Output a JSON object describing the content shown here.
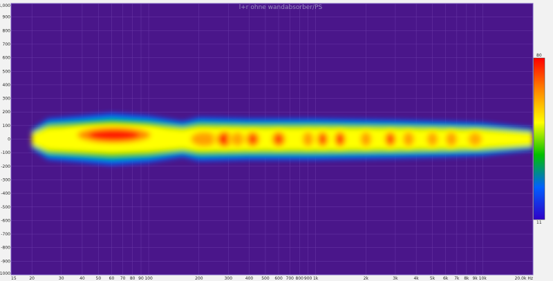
{
  "chart_data": {
    "type": "heatmap",
    "title": "l+r ohne wandabsorber/PS",
    "x_scale": "log",
    "xlim": [
      15,
      20000
    ],
    "ylim": [
      -1000,
      1000
    ],
    "x_tick_labels": [
      {
        "value": 15,
        "label": "15"
      },
      {
        "value": 20,
        "label": "20"
      },
      {
        "value": 30,
        "label": "30"
      },
      {
        "value": 40,
        "label": "40"
      },
      {
        "value": 50,
        "label": "50"
      },
      {
        "value": 60,
        "label": "60"
      },
      {
        "value": 70,
        "label": "70"
      },
      {
        "value": 80,
        "label": "80"
      },
      {
        "value": 90,
        "label": "90"
      },
      {
        "value": 100,
        "label": "100"
      },
      {
        "value": 200,
        "label": "200"
      },
      {
        "value": 300,
        "label": "300"
      },
      {
        "value": 400,
        "label": "400"
      },
      {
        "value": 500,
        "label": "500"
      },
      {
        "value": 600,
        "label": "600"
      },
      {
        "value": 700,
        "label": "700"
      },
      {
        "value": 800,
        "label": "800"
      },
      {
        "value": 900,
        "label": "900"
      },
      {
        "value": 1000,
        "label": "1k"
      },
      {
        "value": 2000,
        "label": "2k"
      },
      {
        "value": 3000,
        "label": "3k"
      },
      {
        "value": 4000,
        "label": "4k"
      },
      {
        "value": 5000,
        "label": "5k"
      },
      {
        "value": 6000,
        "label": "6k"
      },
      {
        "value": 7000,
        "label": "7k"
      },
      {
        "value": 8000,
        "label": "8k"
      },
      {
        "value": 9000,
        "label": "9k"
      },
      {
        "value": 10000,
        "label": "10k"
      },
      {
        "value": 20000,
        "label": "20.0k Hz"
      }
    ],
    "y_tick_labels": [
      {
        "value": 1000,
        "label": "1,000"
      },
      {
        "value": 900,
        "label": "900"
      },
      {
        "value": 800,
        "label": "800"
      },
      {
        "value": 700,
        "label": "700"
      },
      {
        "value": 600,
        "label": "600"
      },
      {
        "value": 500,
        "label": "500"
      },
      {
        "value": 400,
        "label": "400"
      },
      {
        "value": 300,
        "label": "300"
      },
      {
        "value": 200,
        "label": "200"
      },
      {
        "value": 100,
        "label": "100"
      },
      {
        "value": 0,
        "label": "0"
      },
      {
        "value": -100,
        "label": "-100"
      },
      {
        "value": -200,
        "label": "-200"
      },
      {
        "value": -300,
        "label": "-300"
      },
      {
        "value": -400,
        "label": "-400"
      },
      {
        "value": -500,
        "label": "-500"
      },
      {
        "value": -600,
        "label": "-600"
      },
      {
        "value": -700,
        "label": "-700"
      },
      {
        "value": -800,
        "label": "-800"
      },
      {
        "value": -900,
        "label": "-900"
      },
      {
        "value": -1000,
        "label": "-1000"
      }
    ],
    "colorbar": {
      "max_label": "80",
      "min_label": "11",
      "colors": [
        "#ff0000",
        "#ff8800",
        "#ffff00",
        "#00c000",
        "#0060ff",
        "#3000c8"
      ]
    },
    "background_color": "#4a168a",
    "grid": true,
    "heat_band": {
      "center": 0,
      "half_width": [
        {
          "x": 20,
          "value": 70
        },
        {
          "x": 25,
          "value": 150
        },
        {
          "x": 40,
          "value": 170
        },
        {
          "x": 60,
          "value": 190
        },
        {
          "x": 100,
          "value": 170
        },
        {
          "x": 160,
          "value": 130
        },
        {
          "x": 200,
          "value": 160
        },
        {
          "x": 400,
          "value": 150
        },
        {
          "x": 1000,
          "value": 150
        },
        {
          "x": 3000,
          "value": 140
        },
        {
          "x": 6000,
          "value": 130
        },
        {
          "x": 10000,
          "value": 120
        },
        {
          "x": 20000,
          "value": 80
        }
      ]
    },
    "hot_spots": [
      {
        "x": 62,
        "y": 30,
        "intensity": 1.0,
        "width": 0.55
      },
      {
        "x": 215,
        "y": 0,
        "intensity": 0.8,
        "width": 0.2
      },
      {
        "x": 285,
        "y": 0,
        "intensity": 0.95,
        "width": 0.12
      },
      {
        "x": 340,
        "y": 0,
        "intensity": 0.75,
        "width": 0.1
      },
      {
        "x": 420,
        "y": 0,
        "intensity": 0.85,
        "width": 0.1
      },
      {
        "x": 600,
        "y": 0,
        "intensity": 0.85,
        "width": 0.1
      },
      {
        "x": 900,
        "y": 0,
        "intensity": 0.8,
        "width": 0.08
      },
      {
        "x": 1100,
        "y": 0,
        "intensity": 0.85,
        "width": 0.08
      },
      {
        "x": 1400,
        "y": 0,
        "intensity": 0.9,
        "width": 0.08
      },
      {
        "x": 2000,
        "y": 0,
        "intensity": 0.8,
        "width": 0.08
      },
      {
        "x": 2800,
        "y": 0,
        "intensity": 0.85,
        "width": 0.08
      },
      {
        "x": 3600,
        "y": 0,
        "intensity": 0.8,
        "width": 0.08
      },
      {
        "x": 5000,
        "y": 0,
        "intensity": 0.75,
        "width": 0.08
      },
      {
        "x": 6500,
        "y": 0,
        "intensity": 0.8,
        "width": 0.08
      },
      {
        "x": 9000,
        "y": 0,
        "intensity": 0.7,
        "width": 0.1
      }
    ]
  }
}
